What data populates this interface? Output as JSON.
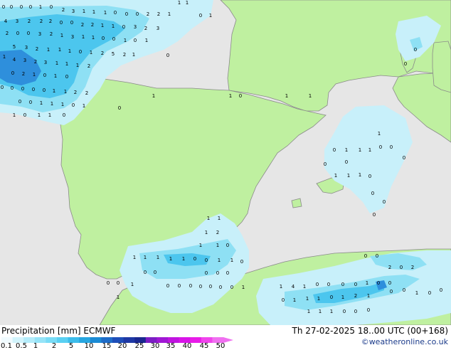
{
  "map": {
    "colors": {
      "sea": "#e6e6e6",
      "land": "#bff0a0",
      "border": "#8a8a8a",
      "precip_light": "#c8f0fa",
      "precip_mid": "#8ee0f4",
      "precip_heavy": "#4cc6ee",
      "precip_max": "#2e8fdc"
    },
    "precip_values": [
      "0",
      "0",
      "0",
      "0",
      "1",
      "0",
      "2",
      "3",
      "1",
      "1",
      "1",
      "0",
      "0",
      "0",
      "2",
      "2",
      "1",
      "1",
      "1",
      "4",
      "3",
      "2",
      "2",
      "2",
      "0",
      "0",
      "2",
      "2",
      "1",
      "1",
      "0",
      "3",
      "2",
      "3",
      "2",
      "0",
      "0",
      "3",
      "2",
      "1",
      "3",
      "1",
      "1",
      "0",
      "0",
      "1",
      "0",
      "1",
      "5",
      "3",
      "2",
      "1",
      "1",
      "1",
      "0",
      "1",
      "2",
      "5",
      "2",
      "1",
      "0",
      "1",
      "4",
      "3",
      "2",
      "3",
      "1",
      "1",
      "1",
      "2",
      "0",
      "2",
      "1",
      "0",
      "1",
      "0",
      "0",
      "0",
      "0",
      "0",
      "0",
      "1",
      "1",
      "2",
      "2",
      "0",
      "0",
      "1",
      "1",
      "1",
      "0",
      "1",
      "1",
      "0",
      "1",
      "1",
      "0",
      "1",
      "1",
      "0",
      "1",
      "1",
      "0",
      "0",
      "1",
      "1",
      "0",
      "1",
      "1",
      "1",
      "0",
      "0",
      "0",
      "0",
      "0",
      "1",
      "1",
      "1",
      "0",
      "0",
      "0",
      "0",
      "0",
      "0",
      "1",
      "1",
      "2",
      "1",
      "1",
      "1",
      "0",
      "1",
      "1",
      "1",
      "1",
      "1",
      "0",
      "0",
      "1",
      "1",
      "0",
      "0",
      "0",
      "0",
      "0",
      "0",
      "0",
      "0",
      "1",
      "0",
      "0",
      "0",
      "0",
      "0",
      "0",
      "0",
      "1",
      "1",
      "1",
      "4",
      "1",
      "0",
      "0",
      "0",
      "0",
      "1",
      "0",
      "0",
      "0",
      "1",
      "1",
      "1",
      "0",
      "1",
      "2",
      "1",
      "1",
      "1",
      "1",
      "0",
      "0",
      "0",
      "0",
      "0",
      "1",
      "0",
      "0",
      "0",
      "0",
      "2",
      "0",
      "2"
    ]
  },
  "legend": {
    "title": "Precipitation [mm] ECMWF",
    "colors": [
      "#f0fbff",
      "#d2f4fc",
      "#b4ecfa",
      "#96e4f8",
      "#78dcf6",
      "#5ad0f2",
      "#3cbcea",
      "#28a6e0",
      "#1a8ad4",
      "#1e6cc8",
      "#1e4eb8",
      "#1e38a4",
      "#1a2890",
      "#7c1ec4",
      "#a018d4",
      "#c014e0",
      "#d814e8",
      "#e81ce8",
      "#f044ec",
      "#f070f0"
    ],
    "ticks": [
      "0.1",
      "0.5",
      "1",
      "2",
      "5",
      "10",
      "15",
      "20",
      "25",
      "30",
      "35",
      "40",
      "45",
      "50"
    ]
  },
  "run_info": "Th 27-02-2025 18..00 UTC (00+168)",
  "credit": "©weatheronline.co.uk"
}
